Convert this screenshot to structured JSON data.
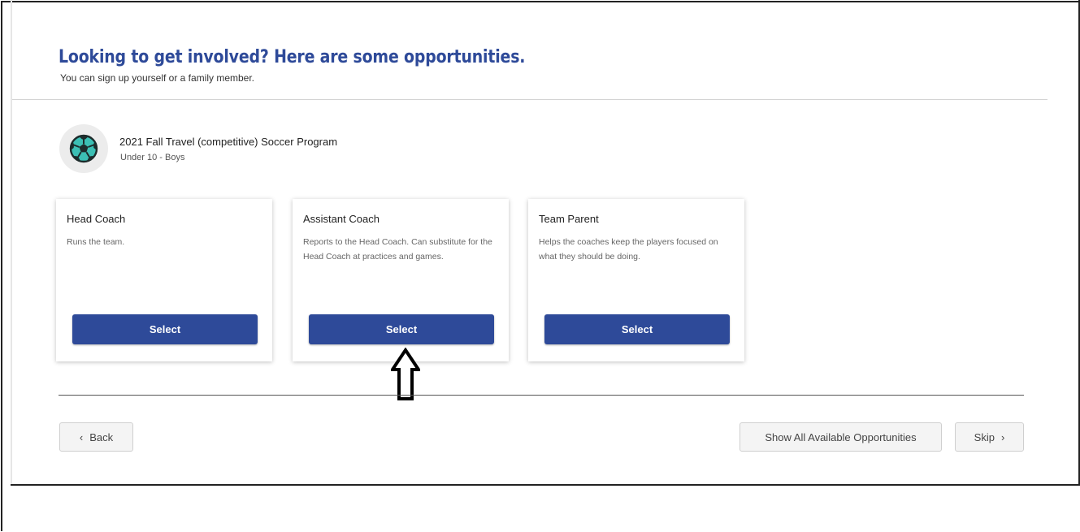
{
  "header": {
    "title": "Looking to get involved? Here are some opportunities.",
    "subtitle": "You can sign up yourself or a family member."
  },
  "program": {
    "icon": "soccer-ball-icon",
    "name": "2021 Fall Travel (competitive) Soccer Program",
    "division": "Under 10 - Boys"
  },
  "opportunities": [
    {
      "title": "Head Coach",
      "description": "Runs the team.",
      "button_label": "Select"
    },
    {
      "title": "Assistant Coach",
      "description": "Reports to the Head Coach. Can substitute for the Head Coach at practices and games.",
      "button_label": "Select"
    },
    {
      "title": "Team Parent",
      "description": "Helps the coaches keep the players focused on what they should be doing.",
      "button_label": "Select"
    }
  ],
  "footer": {
    "back_label": "Back",
    "back_icon": "‹",
    "show_all_label": "Show All Available Opportunities",
    "skip_label": "Skip",
    "skip_icon": "›"
  },
  "colors": {
    "primary": "#2e4a99",
    "soccer_ball": "#3cbfb4",
    "button_text": "#ffffff"
  },
  "annotation": {
    "icon": "up-arrow-icon"
  }
}
